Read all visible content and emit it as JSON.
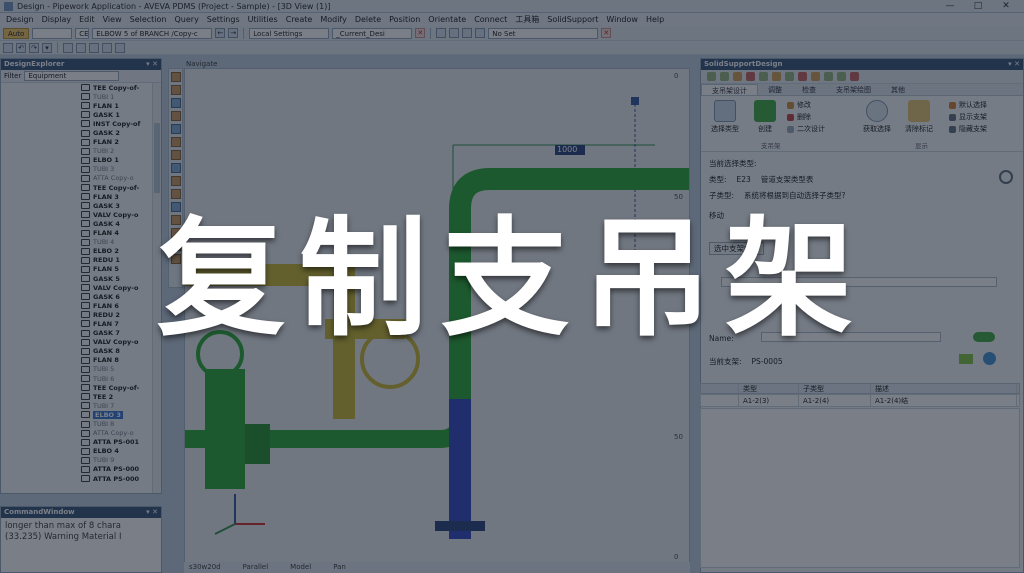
{
  "window": {
    "title": "Design - Pipework Application - AVEVA PDMS (Project - Sample) - [3D View (1)]",
    "controls": [
      "—",
      "□",
      "✕"
    ]
  },
  "menu": [
    "Design",
    "Display",
    "Edit",
    "View",
    "Selection",
    "Query",
    "Settings",
    "Utilities",
    "Create",
    "Modify",
    "Delete",
    "Position",
    "Orientate",
    "Connect",
    "工具箱",
    "SolidSupport",
    "Window",
    "Help"
  ],
  "toolbar": {
    "auto_label": "Auto",
    "ce_label": "CE",
    "element_combo": "ELBOW 5 of BRANCH /Copy-c",
    "settings_combo": "Local Settings",
    "current_combo": "_Current_Desi",
    "set_combo": "No Set"
  },
  "explorer": {
    "title": "DesignExplorer",
    "filter_label": "Filter",
    "filter_value": "Equipment",
    "items": [
      {
        "label": "TEE Copy-of-",
        "style": "bold"
      },
      {
        "label": "TUBI 1",
        "style": "dim"
      },
      {
        "label": "FLAN 1",
        "style": "bold"
      },
      {
        "label": "GASK 1",
        "style": "bold"
      },
      {
        "label": "INST Copy-of",
        "style": "bold"
      },
      {
        "label": "GASK 2",
        "style": "bold"
      },
      {
        "label": "FLAN 2",
        "style": "bold"
      },
      {
        "label": "TUBI 2",
        "style": "dim"
      },
      {
        "label": "ELBO 1",
        "style": "bold"
      },
      {
        "label": "TUBI 3",
        "style": "dim"
      },
      {
        "label": "ATTA Copy-o",
        "style": "dim"
      },
      {
        "label": "TEE Copy-of-",
        "style": "bold"
      },
      {
        "label": "FLAN 3",
        "style": "bold"
      },
      {
        "label": "GASK 3",
        "style": "bold"
      },
      {
        "label": "VALV Copy-o",
        "style": "bold"
      },
      {
        "label": "GASK 4",
        "style": "bold"
      },
      {
        "label": "FLAN 4",
        "style": "bold"
      },
      {
        "label": "TUBI 4",
        "style": "dim"
      },
      {
        "label": "ELBO 2",
        "style": "bold"
      },
      {
        "label": "REDU 1",
        "style": "bold"
      },
      {
        "label": "FLAN 5",
        "style": "bold"
      },
      {
        "label": "GASK 5",
        "style": "bold"
      },
      {
        "label": "VALV Copy-o",
        "style": "bold"
      },
      {
        "label": "GASK 6",
        "style": "bold"
      },
      {
        "label": "FLAN 6",
        "style": "bold"
      },
      {
        "label": "REDU 2",
        "style": "bold"
      },
      {
        "label": "FLAN 7",
        "style": "bold"
      },
      {
        "label": "GASK 7",
        "style": "bold"
      },
      {
        "label": "VALV Copy-o",
        "style": "bold"
      },
      {
        "label": "GASK 8",
        "style": "bold"
      },
      {
        "label": "FLAN 8",
        "style": "bold"
      },
      {
        "label": "TUBI 5",
        "style": "dim"
      },
      {
        "label": "TUBI 6",
        "style": "dim"
      },
      {
        "label": "TEE Copy-of-",
        "style": "bold"
      },
      {
        "label": "TEE 2",
        "style": "bold"
      },
      {
        "label": "TUBI 7",
        "style": "dim"
      },
      {
        "label": "ELBO 3",
        "style": "sel"
      },
      {
        "label": "TUBI 8",
        "style": "dim"
      },
      {
        "label": "ATTA Copy-o",
        "style": "dim"
      },
      {
        "label": "ATTA PS-001",
        "style": "bold"
      },
      {
        "label": "ELBO 4",
        "style": "bold"
      },
      {
        "label": "TUBI 9",
        "style": "dim"
      },
      {
        "label": "ATTA PS-000",
        "style": "bold"
      },
      {
        "label": "ATTA PS-000",
        "style": "bold"
      }
    ]
  },
  "command_window": {
    "title": "CommandWindow",
    "lines": [
      "longer than max of 8 chara",
      "(33.235) Warning  Material I"
    ]
  },
  "viewport": {
    "label": "Navigate",
    "dimension_text": "1000",
    "ruler_ticks": [
      "0",
      "50",
      "50",
      "0"
    ],
    "status": [
      "s30w20d",
      "Parallel",
      "Model",
      "Pan"
    ]
  },
  "support_panel": {
    "title": "SolidSupportDesign",
    "tabs": [
      "支吊架设计",
      "调整",
      "检查",
      "支吊架绘图",
      "其他"
    ],
    "ribbon": {
      "select_type": "选择类型",
      "create": "创建",
      "modify": "修改",
      "delete": "删除",
      "secondary_design": "二次设计",
      "group_design": "支吊架",
      "pick_select": "获取选择",
      "clear_marks": "清除标记",
      "default_select": "默认选择",
      "show_support": "显示支架",
      "hide_support": "隐藏支架",
      "group_display": "显示"
    },
    "form": {
      "selected_type_label": "当前选择类型:",
      "type_label": "类型:",
      "type_code": "E23",
      "type_desc": "管道支架类型表",
      "subtype_label": "子类型:",
      "subtype_desc": "系统将根据到自动选择子类型?",
      "section_label": "移动",
      "center_btn": "选中支架中心",
      "name_label": "Name:",
      "current_support_label": "当前支架:",
      "current_support_value": "PS-0005"
    },
    "grid": {
      "headers": [
        "",
        "类型",
        "子类型",
        "描述"
      ],
      "row": [
        "",
        "A1-2(3)",
        "A1-2(4)",
        "A1-2(4)结"
      ]
    }
  },
  "overlay": {
    "headline": "复制支吊架"
  }
}
